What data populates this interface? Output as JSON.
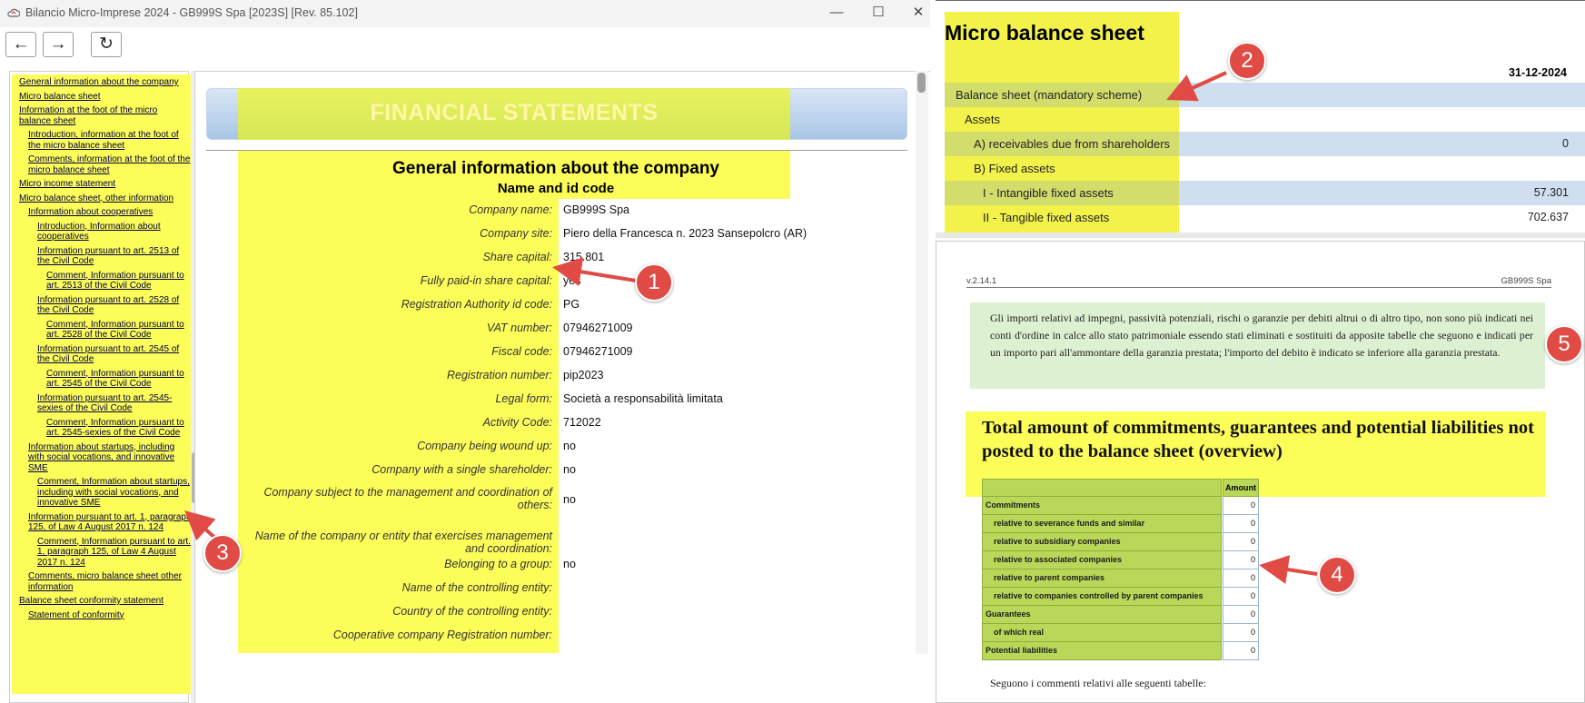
{
  "window": {
    "title": "Bilancio Micro-Imprese 2024 - GB999S Spa  [2023S] [Rev. 85.102]",
    "minimize": "—",
    "maximize": "☐",
    "close": "✕"
  },
  "toolbar": {
    "back": "←",
    "forward": "→",
    "refresh": "↻"
  },
  "nav": [
    {
      "label": "General information about the company",
      "level": 0
    },
    {
      "label": "Micro balance sheet",
      "level": 0
    },
    {
      "label": "Information at the foot of the micro balance sheet",
      "level": 0
    },
    {
      "label": "Introduction, information at the foot of the micro balance sheet",
      "level": 1
    },
    {
      "label": "Comments, information at the foot of the micro balance sheet",
      "level": 1
    },
    {
      "label": "Micro income statement",
      "level": 0
    },
    {
      "label": "Micro balance sheet, other information",
      "level": 0
    },
    {
      "label": "Information about cooperatives",
      "level": 1
    },
    {
      "label": "Introduction, Information about cooperatives",
      "level": 2
    },
    {
      "label": "Information pursuant to art. 2513 of the Civil Code",
      "level": 2
    },
    {
      "label": "Comment, Information pursuant to art. 2513 of the Civil Code",
      "level": 3
    },
    {
      "label": "Information pursuant to art. 2528 of the Civil Code",
      "level": 2
    },
    {
      "label": "Comment, Information pursuant to art. 2528 of the Civil Code",
      "level": 3
    },
    {
      "label": "Information pursuant to art. 2545 of the Civil Code",
      "level": 2
    },
    {
      "label": "Comment, Information pursuant to art. 2545 of the Civil Code",
      "level": 3
    },
    {
      "label": "Information pursuant to art. 2545-sexies of the Civil Code",
      "level": 2
    },
    {
      "label": "Comment, Information pursuant to art. 2545-sexies of the Civil Code",
      "level": 3
    },
    {
      "label": "Information about startups, including with social vocations, and innovative SME",
      "level": 1
    },
    {
      "label": "Comment, Information about startups, including with social vocations, and innovative SME",
      "level": 2
    },
    {
      "label": "Information pursuant to art. 1, paragraph 125, of Law 4 August 2017 n. 124",
      "level": 1
    },
    {
      "label": "Comment, Information pursuant to art. 1, paragraph 125, of Law 4 August 2017 n. 124",
      "level": 2
    },
    {
      "label": "Comments, micro balance sheet other information",
      "level": 1
    },
    {
      "label": "Balance sheet conformity statement",
      "level": 0
    },
    {
      "label": "Statement of conformity",
      "level": 1
    }
  ],
  "main": {
    "banner": "FINANCIAL STATEMENTS",
    "section_title": "General information about the company",
    "section_subtitle": "Name and id code",
    "fields": [
      {
        "label": "Company name:",
        "value": "GB999S Spa"
      },
      {
        "label": "Company site:",
        "value": "Piero della Francesca n. 2023 Sansepolcro (AR)"
      },
      {
        "label": "Share capital:",
        "value": "315.801"
      },
      {
        "label": "Fully paid-in share capital:",
        "value": "yes"
      },
      {
        "label": "Registration Authority id code:",
        "value": "PG"
      },
      {
        "label": "VAT number:",
        "value": "07946271009"
      },
      {
        "label": "Fiscal code:",
        "value": "07946271009"
      },
      {
        "label": "Registration number:",
        "value": "pip2023"
      },
      {
        "label": "Legal form:",
        "value": "Società a responsabilità limitata"
      },
      {
        "label": "Activity Code:",
        "value": "712022"
      },
      {
        "label": "Company being wound up:",
        "value": "no"
      },
      {
        "label": "Company with a single shareholder:",
        "value": "no"
      },
      {
        "label": "Company subject to the management and coordination of others:",
        "value": "no"
      },
      {
        "label": "Name of the company or entity that exercises management and coordination:",
        "value": ""
      },
      {
        "label": "Belonging to a group:",
        "value": "no"
      },
      {
        "label": "Name of the controlling entity:",
        "value": ""
      },
      {
        "label": "Country of the controlling entity:",
        "value": ""
      },
      {
        "label": "Cooperative company Registration number:",
        "value": ""
      }
    ]
  },
  "balance": {
    "title": "Micro balance sheet",
    "date": "31-12-2024",
    "rows": [
      {
        "label": "Balance sheet (mandatory scheme)",
        "value": "",
        "indent": 0,
        "shaded": true
      },
      {
        "label": "Assets",
        "value": "",
        "indent": 1,
        "shaded": false
      },
      {
        "label": "A) receivables due from shareholders",
        "value": "0",
        "indent": 2,
        "shaded": true
      },
      {
        "label": "B) Fixed assets",
        "value": "",
        "indent": 2,
        "shaded": false
      },
      {
        "label": "I - Intangible fixed assets",
        "value": "57.301",
        "indent": 3,
        "shaded": true
      },
      {
        "label": "II - Tangible fixed assets",
        "value": "702.637",
        "indent": 3,
        "shaded": false
      }
    ]
  },
  "preview": {
    "version": "v.2.14.1",
    "company": "GB999S Spa",
    "note": "Gli importi relativi ad impegni, passività potenziali, rischi o garanzie per debiti altrui o di altro tipo, non sono più indicati nei conti d'ordine in calce allo stato patrimoniale essendo stati eliminati e sostituiti da apposite tabelle che seguono e indicati per un importo pari all'ammontare della garanzia prestata; l'importo del debito è indicato se inferiore alla garanzia prestata.",
    "total_title": "Total amount of commitments, guarantees and potential liabilities not posted to the balance sheet (overview)",
    "amount_header": "Amount",
    "rows": [
      {
        "label": "Commitments",
        "value": "0",
        "indent": false
      },
      {
        "label": "relative to severance funds and similar",
        "value": "0",
        "indent": true
      },
      {
        "label": "relative to subsidiary companies",
        "value": "0",
        "indent": true
      },
      {
        "label": "relative to associated companies",
        "value": "0",
        "indent": true
      },
      {
        "label": "relative to parent companies",
        "value": "0",
        "indent": true
      },
      {
        "label": "relative to companies controlled by parent companies",
        "value": "0",
        "indent": true
      },
      {
        "label": "Guarantees",
        "value": "0",
        "indent": false
      },
      {
        "label": "of which real",
        "value": "0",
        "indent": true
      },
      {
        "label": "Potential liabilities",
        "value": "0",
        "indent": false
      }
    ],
    "footer": "Seguono i commenti relativi alle seguenti tabelle:"
  },
  "callouts": [
    "1",
    "2",
    "3",
    "4",
    "5"
  ],
  "colors": {
    "highlight": "#fdfd5a",
    "callout": "#e04b45",
    "banner": "#a9c6e6",
    "note_bg": "#ddf0d2"
  }
}
